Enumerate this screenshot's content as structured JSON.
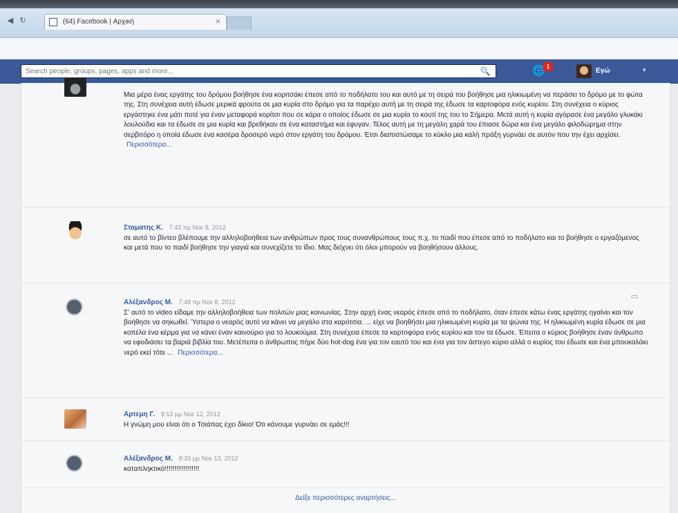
{
  "browser": {
    "tab_title": "(64) Facebook | Αρχική",
    "tab_close": "×",
    "back_glyph": "◀",
    "reload_glyph": "↻"
  },
  "facebar": {
    "search_placeholder": "Search people, groups, pages, apps and more...",
    "search_icon": "search-icon",
    "notif_count": "1",
    "user_name": "Εγώ",
    "chevron": "▾"
  },
  "comments": [
    {
      "author": "",
      "time": "",
      "text": "Μια μέρα ένας εργάτης του δρόμου βοήθησε ένα κοριτσάκι έπεσε από το ποδήλατο του και αυτό με τη σειρά του βοήθησε μια ηλικιωμένη να περάσει το δρόμο με το φώτα της. Στη συνέχεια αυτή έδωσε μερικά φρούτα σε μια κυρία στο δρόμο για τα παρέχει αυτή με τη σειρά της έδωσε τα καρτοφόρα ενός κυρίου. Στη συνέχεια ο κύριος εργάστηκε ένα μάτι ποτέ για έναν μεταφορά κορίτσι που σε κάρα ο οποίος έδωσε σε μια κυρία το κουτί της του το Σήμερα. Μετά αυτή η κυρία αγόρασε ένα μεγάλο γλυκάκι λουλούδια και τα έδωσε σε μια κυρία και βρεθήκαν σε ένα καταστήμα και έφυγαν. Τέλος αυτή με τη μεγάλη χαρά του έπιασε δώρα και ένα μεγάλο φιλοδώρημα στην σερβιτόρο η οποία έδωσε ένα κασέρα δροσερό νερό στον εργάτη του δρόμου. Έτσι διαπιστώσαμε το κύκλο μια καλή πράξη γυρνάει σε αυτόν που την έχει αρχίσει.",
      "more": "Περισσότερα..."
    },
    {
      "author": "Σταματης Κ.",
      "time": "7:43 πμ Νοε 8, 2012",
      "text": "σε αυτό το βίντεο βλέπουμε την αλληλοβοήθεια των ανθρώπων προς τους συνανθρώπους τους π.χ. το παιδί που έπεσε από το ποδήλατο και το βοήθησε ο εργαζόμενος και μετά που το παιδί βοήθησε την γιαγιά και συνεχίζετε το ίδιο. Μας δείχνει ότι όλοι μπορούν να βοηθήσουν άλλους.",
      "more": ""
    },
    {
      "author": "Αλέξανδρος Μ.",
      "time": "7:48 πμ Νοε 8, 2012",
      "text": "Σ' αυτό το video είδαμε την αλληλοβοήθεια των πολιτών μιας κοινωνίας. Στην αρχή ένας νεαρός έπεσε από το ποδήλατο, όταν έπεσε κάτω ένας εργάτης ηγαίνει και τον βοήθησε να σηκωθεί. Ύστερα ο νεαρός αυτό να κάνει να μεγάλο στα καρότσια. ... είχε να βοηθήσει μια ηλικιωμένη κυρία με τα ψώνια της. Η ηλικιωμένη κυρία έδωσε σε μια κοπέλα ένα κέρμα για να κάνει έναν καινούριο για το λουκούμια. Στη συνέχεια έπεσε τα καρτοφόρα ενός κυρίου και τον τα έδωσε. Έπειτα ο κύριος βοήθησε έναν άνθρωπο να εφοδιάσει τα βαριά βιβλία του. Μετέπειτα ο άνθρωπος πήρε δύο hot-dog ένα για τον εαυτό του και ένα για τον άστεγο κύριο αλλά ο κυρίος του έδωσε και ένα μπουκαλάκι νερό εκεί τότε ...",
      "more": "Περισσότερα..."
    },
    {
      "author": "Αρτεμη Γ.",
      "time": "8:12 μμ Νοε 12, 2012",
      "text": "Η γνώμη μου είναι ότι ο Τσιάπας έχει δίκιο! Ότι κάνουμε γυρνάει σε εμάς!!!",
      "more": ""
    },
    {
      "author": "Αλέξανδρος Μ.",
      "time": "8:33 μμ Νοε 13, 2012",
      "text": "καταπληκτικό!!!!!!!!!!!!!!!!!!",
      "more": ""
    }
  ],
  "show_more_label": "Δείξε περισσότερες αναρτήσεις...",
  "colors": {
    "facebook_blue": "#3b5998",
    "link_blue": "#365899",
    "badge_red": "#e0241c"
  }
}
